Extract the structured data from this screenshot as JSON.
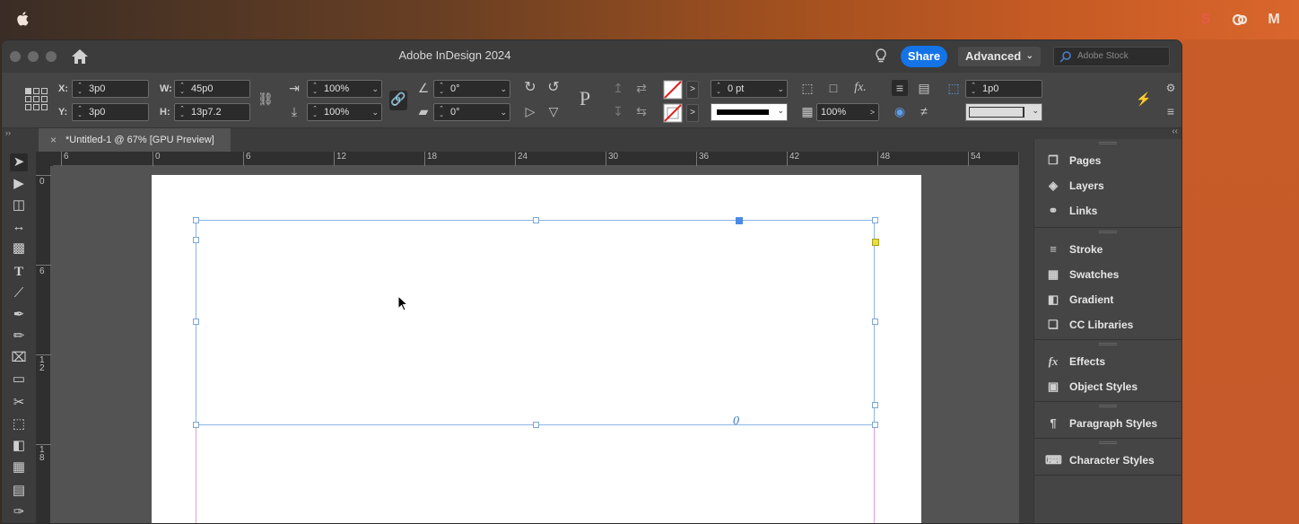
{
  "menubar": {
    "icons": [
      "apple-icon",
      "s-icon",
      "creative-cloud-icon",
      "m-icon"
    ]
  },
  "window": {
    "title": "Adobe InDesign 2024",
    "share_label": "Share",
    "workspace_label": "Advanced",
    "stock_placeholder": "Adobe Stock"
  },
  "control": {
    "x_label": "X:",
    "x_value": "3p0",
    "y_label": "Y:",
    "y_value": "3p0",
    "w_label": "W:",
    "w_value": "45p0",
    "h_label": "H:",
    "h_value": "13p7.2",
    "scale_x": "100%",
    "scale_y": "100%",
    "shear_angle": "0°",
    "rotate_angle": "0°",
    "stroke_weight": "0 pt",
    "opacity": "100%",
    "corner_size": "1p0"
  },
  "tab": {
    "close": "×",
    "title": "*Untitled-1 @ 67% [GPU Preview]"
  },
  "ruler": {
    "h_ticks": [
      "6",
      "0",
      "6",
      "12",
      "18",
      "24",
      "30",
      "36",
      "42",
      "48",
      "54"
    ],
    "v_ticks": [
      "0",
      "6",
      "1\n2",
      "1\n8"
    ]
  },
  "panels": {
    "groups": [
      [
        {
          "icon": "pages-icon",
          "label": "Pages"
        },
        {
          "icon": "layers-icon",
          "label": "Layers"
        },
        {
          "icon": "links-icon",
          "label": "Links"
        }
      ],
      [
        {
          "icon": "stroke-icon",
          "label": "Stroke"
        },
        {
          "icon": "swatches-icon",
          "label": "Swatches"
        },
        {
          "icon": "gradient-icon",
          "label": "Gradient"
        },
        {
          "icon": "cc-libraries-icon",
          "label": "CC Libraries"
        }
      ],
      [
        {
          "icon": "effects-icon",
          "label": "Effects"
        },
        {
          "icon": "object-styles-icon",
          "label": "Object Styles"
        }
      ],
      [
        {
          "icon": "paragraph-styles-icon",
          "label": "Paragraph Styles"
        }
      ],
      [
        {
          "icon": "character-styles-icon",
          "label": "Character Styles"
        }
      ]
    ]
  },
  "colors": {
    "accent": "#1473e6",
    "frame_border": "#8cb5e2",
    "margin_guide": "#e0a0d8"
  }
}
